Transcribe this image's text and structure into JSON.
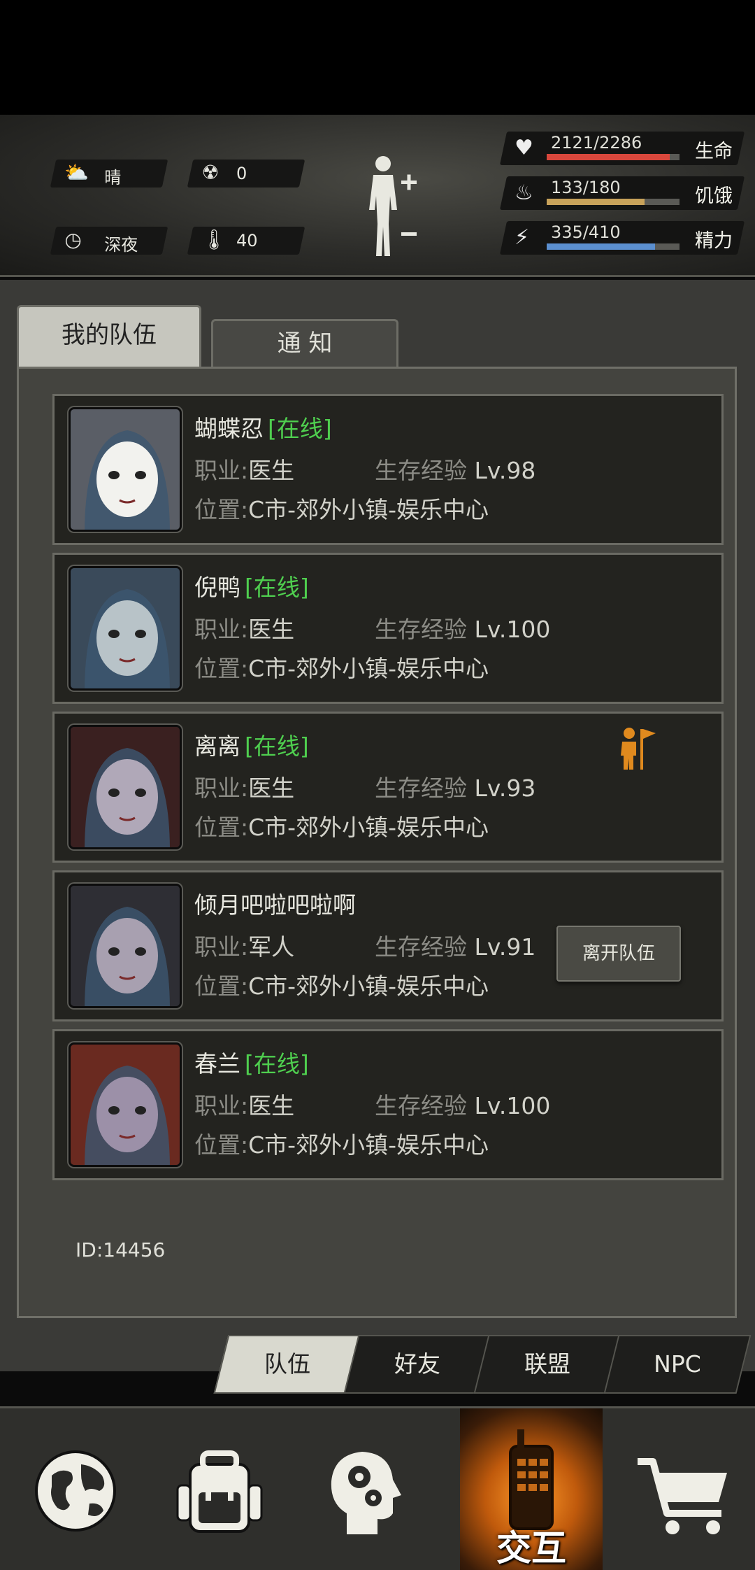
{
  "status": {
    "weather": "晴",
    "radiation": "0",
    "time_of_day": "深夜",
    "temperature": "40",
    "stats": [
      {
        "icon": "heart-icon",
        "value": "2121/2286",
        "label": "生命",
        "fill": 0.928,
        "color": "#d9473c"
      },
      {
        "icon": "stomach-icon",
        "value": "133/180",
        "label": "饥饿",
        "fill": 0.739,
        "color": "#c8a25a"
      },
      {
        "icon": "head-energy-icon",
        "value": "335/410",
        "label": "精力",
        "fill": 0.817,
        "color": "#5b8fd0"
      }
    ]
  },
  "tabs": {
    "my_team": "我的队伍",
    "notice": "通 知"
  },
  "labels": {
    "job": "职业:",
    "exp": "生存经验",
    "location": "位置:",
    "online": "[在线]",
    "leave_team": "离开队伍"
  },
  "members": [
    {
      "name": "蝴蝶忍",
      "online": true,
      "job": "医生",
      "level": "Lv.98",
      "location": "C市-郊外小镇-娱乐中心",
      "avatar": "mask"
    },
    {
      "name": "倪鸭",
      "online": true,
      "job": "医生",
      "level": "Lv.100",
      "location": "C市-郊外小镇-娱乐中心",
      "avatar": "flower"
    },
    {
      "name": "离离",
      "online": true,
      "job": "医生",
      "level": "Lv.93",
      "location": "C市-郊外小镇-娱乐中心",
      "avatar": "devil",
      "leader": true
    },
    {
      "name": "倾月吧啦吧啦啊",
      "online": false,
      "job": "军人",
      "level": "Lv.91",
      "location": "C市-郊外小镇-娱乐中心",
      "avatar": "officer"
    },
    {
      "name": "春兰",
      "online": true,
      "job": "医生",
      "level": "Lv.100",
      "location": "C市-郊外小镇-娱乐中心",
      "avatar": "hood"
    }
  ],
  "player_id": "ID:14456",
  "subtabs": [
    "队伍",
    "好友",
    "联盟",
    "NPC"
  ],
  "nav": {
    "items": [
      "globe-icon",
      "backpack-icon",
      "head-gear-icon",
      "walkie-talkie-icon",
      "cart-icon"
    ],
    "active_label": "交互"
  }
}
